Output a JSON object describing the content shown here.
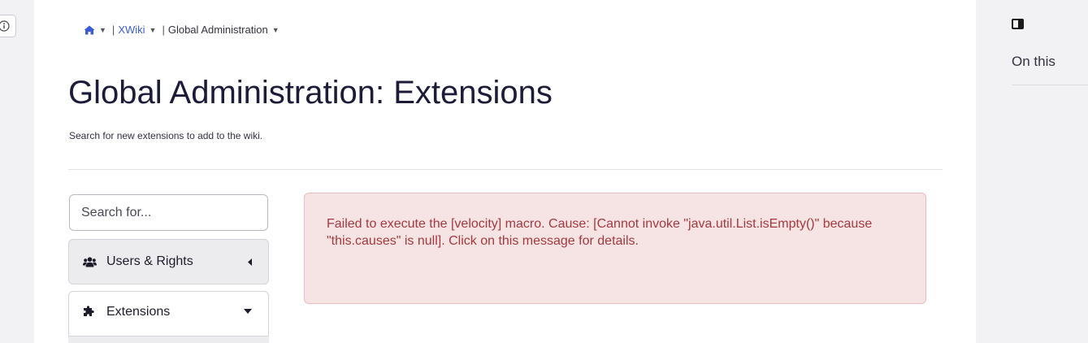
{
  "breadcrumb": {
    "home_icon": "home-icon",
    "wiki_link": "XWiki",
    "current": "Global Administration"
  },
  "page": {
    "title": "Global Administration: Extensions",
    "description": "Search for new extensions to add to the wiki."
  },
  "admin_menu": {
    "search_placeholder": "Search for...",
    "items": [
      {
        "label": "Users & Rights",
        "icon": "users-icon",
        "state": "collapsed"
      },
      {
        "label": "Extensions",
        "icon": "puzzle-icon",
        "state": "expanded"
      }
    ]
  },
  "error": {
    "message": "Failed to execute the [velocity] macro. Cause: [Cannot invoke \"java.util.List.isEmpty()\" because \"this.causes\" is null]. Click on this message for details."
  },
  "right_panel": {
    "toggle_icon": "panel-toggle-icon",
    "heading": "On this"
  },
  "colors": {
    "link": "#3b5bdb",
    "error_bg": "#f6e3e4",
    "error_text": "#a43a3f",
    "side_bg": "#f2f2f5"
  }
}
